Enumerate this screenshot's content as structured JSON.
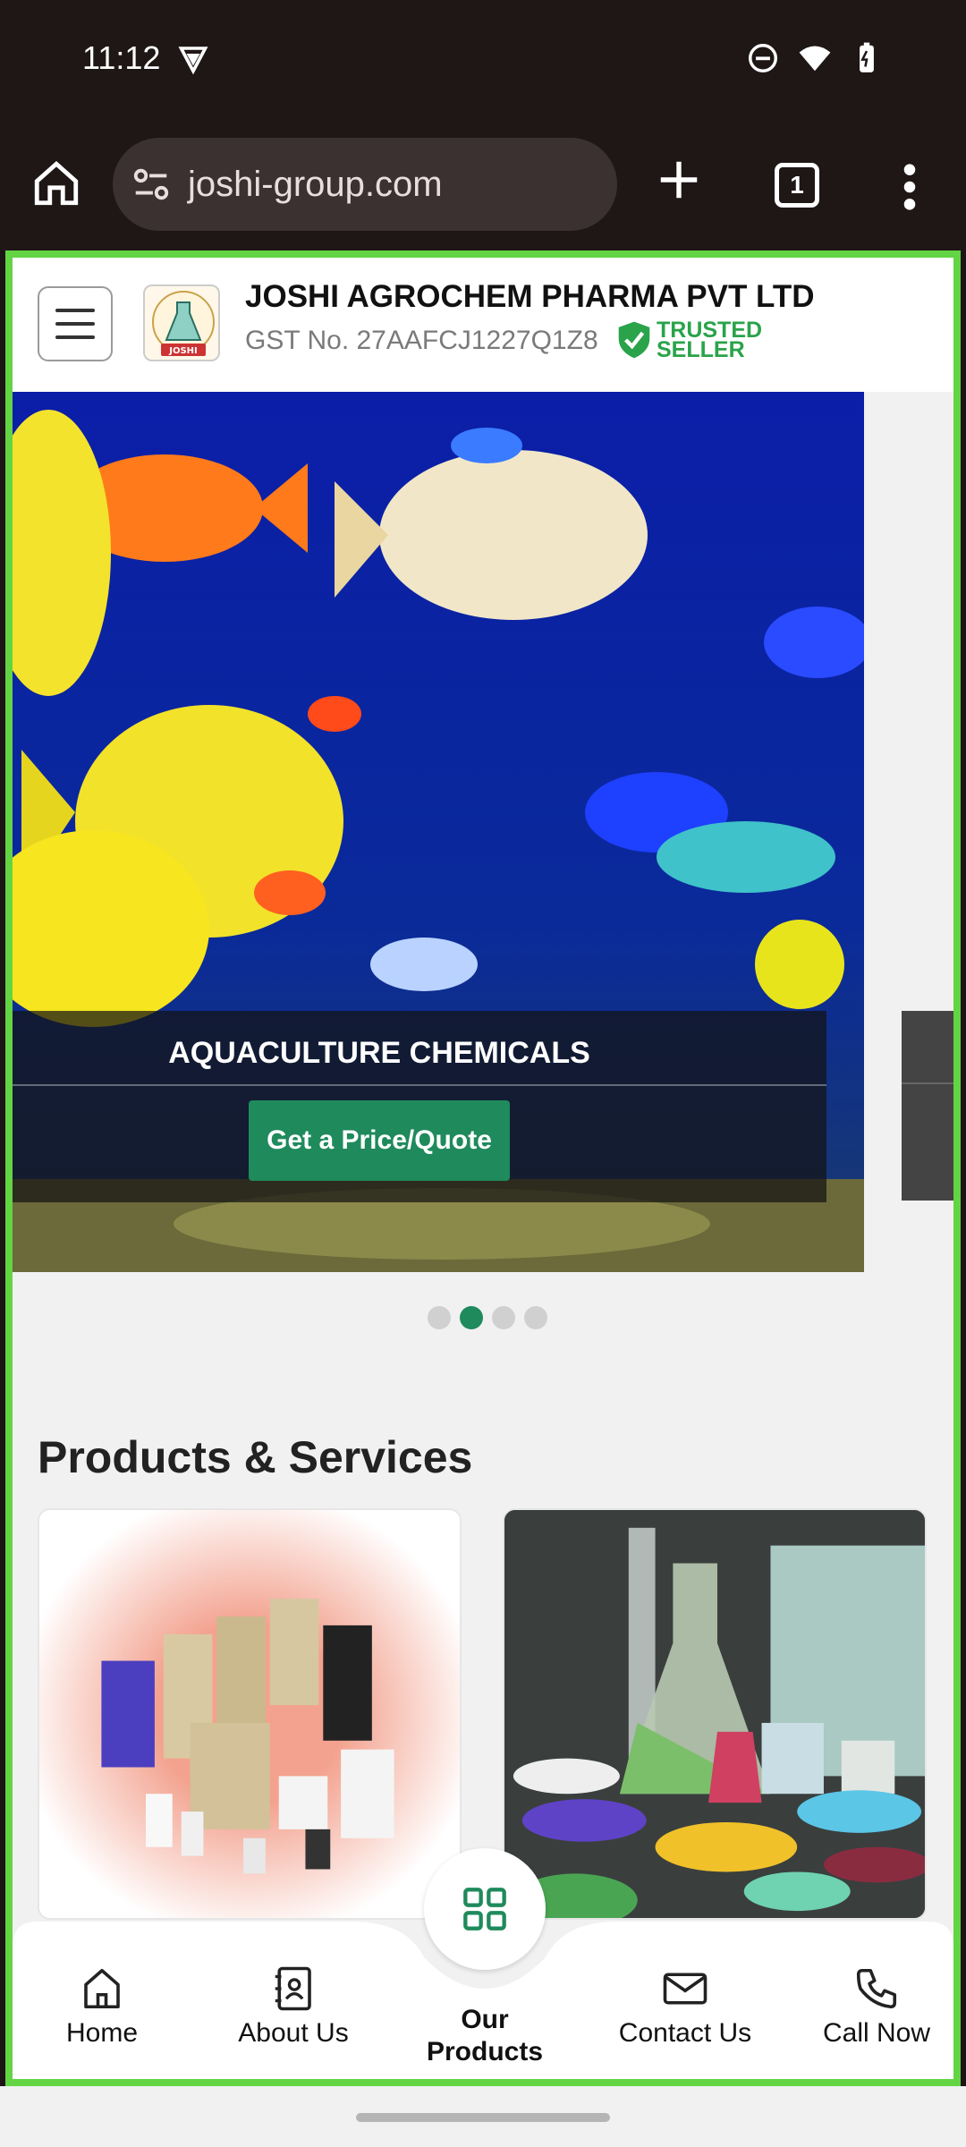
{
  "status_bar": {
    "time": "11:12"
  },
  "browser": {
    "url": "joshi-group.com",
    "tab_count": "1"
  },
  "header": {
    "company_name": "JOSHI AGROCHEM PHARMA PVT LTD",
    "gst": "GST No. 27AAFCJ1227Q1Z8",
    "trusted_line1": "TRUSTED",
    "trusted_line2": "SELLER",
    "logo_text": "JOSHI"
  },
  "hero": {
    "title": "AQUACULTURE CHEMICALS",
    "cta_label": "Get a Price/Quote",
    "slide_count": 4,
    "active_slide": 2
  },
  "products_section": {
    "title": "Products & Services"
  },
  "bottom_nav": {
    "home": "Home",
    "about": "About Us",
    "products_line1": "Our",
    "products_line2": "Products",
    "contact": "Contact Us",
    "call": "Call Now"
  },
  "colors": {
    "accent_green": "#1f8a5c",
    "frame_green": "#63d444",
    "trusted_green": "#2aa34a"
  }
}
